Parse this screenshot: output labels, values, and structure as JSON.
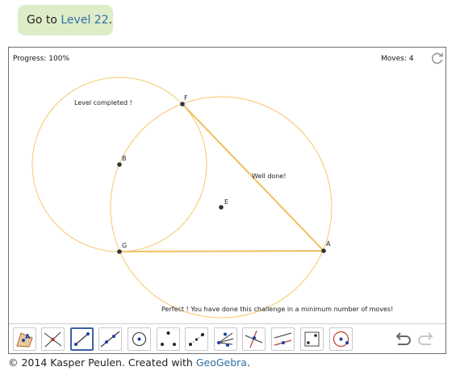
{
  "goto": {
    "prefix": "Go to ",
    "link": "Level 22",
    "suffix": "."
  },
  "status": {
    "progress": "Progress: 100%",
    "moves": "Moves: 4"
  },
  "canvas": {
    "messages": {
      "level_completed": "Level completed !",
      "well_done": "Well done!",
      "perfect": "Perfect ! You have done this challenge in a minimum number of moves!"
    },
    "points": {
      "F": "F",
      "B": "B",
      "E": "E",
      "G": "G",
      "A": "A"
    },
    "colors": {
      "circle": "#f5c76a",
      "segment": "#f0c060",
      "point": "#333333"
    }
  },
  "toolbar": {
    "tools": [
      "polygon-with-point-tool",
      "intersect-tool",
      "segment-tool",
      "line-tool",
      "circle-with-center-tool",
      "triangle-points-tool",
      "dashed-points-tool",
      "angle-bisector-tool",
      "perpendicular-line-tool",
      "parallel-line-tool",
      "point-in-square-tool",
      "compass-tool"
    ],
    "selected_tool": "segment-tool",
    "undo": "undo-icon",
    "redo": "redo-icon"
  },
  "credit": {
    "text": "© 2014 Kasper Peulen. Created with ",
    "link": "GeoGebra",
    "suffix": "."
  }
}
